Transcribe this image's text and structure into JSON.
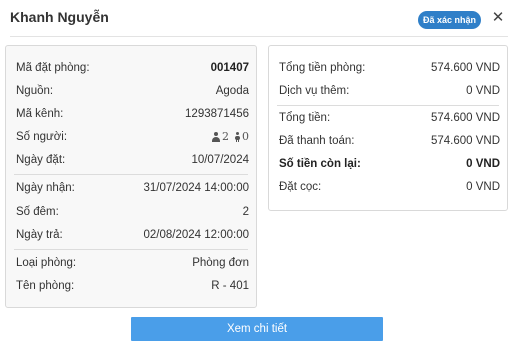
{
  "header": {
    "title": "Khanh Nguyễn",
    "status_badge": "Đã xác nhận",
    "close_icon": "close-icon"
  },
  "booking": {
    "code": {
      "label": "Mã đặt phòng:",
      "value": "001407"
    },
    "source": {
      "label": "Nguồn:",
      "value": "Agoda"
    },
    "channel_code": {
      "label": "Mã kênh:",
      "value": "1293871456"
    },
    "guests": {
      "label": "Số người:",
      "adults": "2",
      "children": "0"
    },
    "booking_date": {
      "label": "Ngày đặt:",
      "value": "10/07/2024"
    },
    "check_in": {
      "label": "Ngày nhận:",
      "value": "31/07/2024 14:00:00"
    },
    "nights": {
      "label": "Số đêm:",
      "value": "2"
    },
    "check_out": {
      "label": "Ngày trả:",
      "value": "02/08/2024 12:00:00"
    },
    "room_type": {
      "label": "Loại phòng:",
      "value": "Phòng đơn"
    },
    "room_name": {
      "label": "Tên phòng:",
      "value": "R - 401"
    }
  },
  "payment": {
    "room_total": {
      "label": "Tổng tiền phòng:",
      "value": "574.600 VND"
    },
    "extra_services": {
      "label": "Dịch vụ thêm:",
      "value": "0 VND"
    },
    "total": {
      "label": "Tổng tiền:",
      "value": "574.600 VND"
    },
    "paid": {
      "label": "Đã thanh toán:",
      "value": "574.600 VND"
    },
    "remaining": {
      "label": "Số tiền còn lại:",
      "value": "0 VND"
    },
    "deposit": {
      "label": "Đặt cọc:",
      "value": "0 VND"
    }
  },
  "actions": {
    "view_details": "Xem chi tiết"
  },
  "colors": {
    "badge": "#2f7fc8",
    "primary_button": "#4a9ee9"
  }
}
